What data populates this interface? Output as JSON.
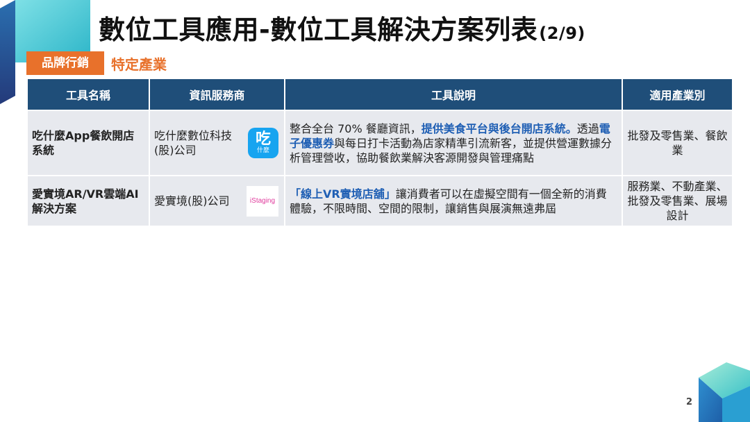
{
  "header": {
    "title": "數位工具應用-數位工具解決方案列表",
    "page_indicator": "(2/9)"
  },
  "tags": {
    "primary": "品牌行銷",
    "secondary": "特定產業"
  },
  "table": {
    "headers": [
      "工具名稱",
      "資訊服務商",
      "工具說明",
      "適用產業別"
    ],
    "rows": [
      {
        "name": "吃什麼App餐飲開店系統",
        "provider": "吃什麼數位科技(股)公司",
        "logo_glyph": "吃",
        "logo_sub": "什麼",
        "desc_1": "整合全台 70% 餐廳資訊，",
        "desc_2": "提供美食平台與後台開店系統。",
        "desc_3": "透過",
        "desc_4": "電子優惠券",
        "desc_5": "與每日打卡活動為店家精準引流新客，並提供營運數據分析管理營收，協助餐飲業解決客源開發與管理痛點",
        "industry": "批發及零售業、餐飲業"
      },
      {
        "name": "愛實境AR/VR雲端AI解決方案",
        "provider": "愛實境(股)公司",
        "logo_text": "iStaging",
        "desc_1": "「線上VR實境店舖」",
        "desc_2": "讓消費者可以在虛擬空間有一個全新的消費體驗，不限時間、空間的限制，讓銷售與展演無遠弗屆",
        "industry": "服務業、不動產業、批發及零售業、展場設計"
      }
    ]
  },
  "footer": {
    "page_number": "2"
  },
  "colors": {
    "header_bg": "#1f4e79",
    "tag_orange": "#e8712b",
    "highlight_blue": "#1f5fb4",
    "row_bg": "#e7e9ee"
  }
}
